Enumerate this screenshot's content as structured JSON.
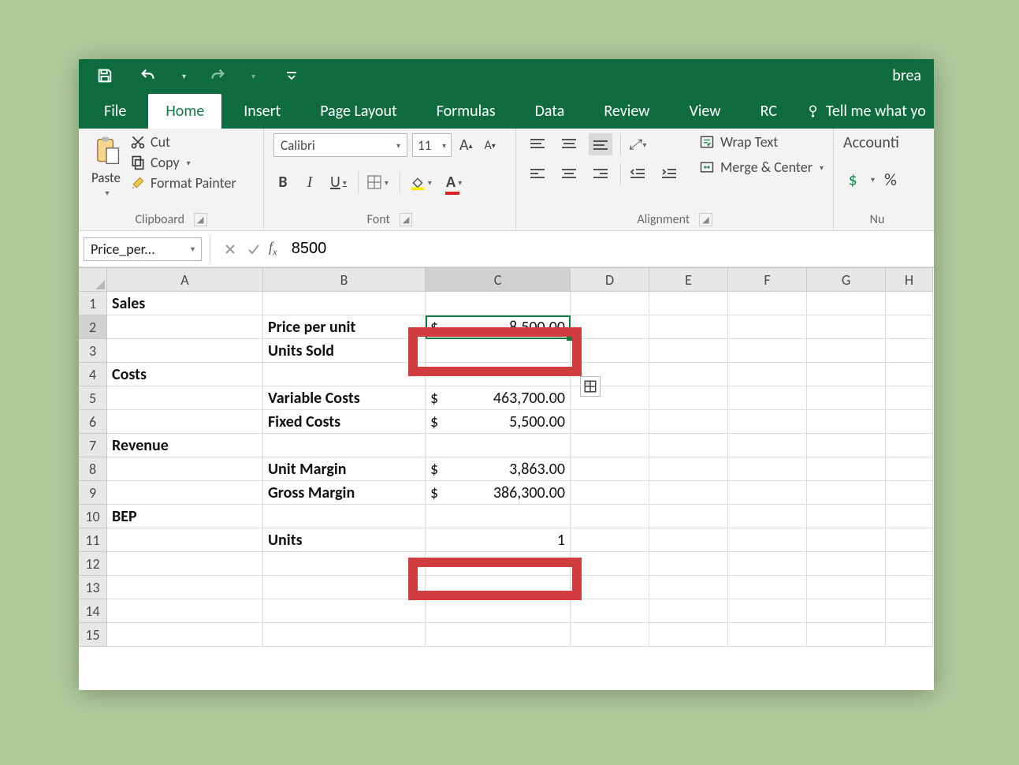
{
  "doc_title": "brea",
  "tabs": {
    "file": "File",
    "home": "Home",
    "insert": "Insert",
    "page_layout": "Page Layout",
    "formulas": "Formulas",
    "data": "Data",
    "review": "Review",
    "view": "View",
    "rc": "RC",
    "tell_me": "Tell me what yo"
  },
  "clipboard": {
    "paste": "Paste",
    "cut": "Cut",
    "copy": "Copy",
    "format_painter": "Format Painter",
    "group": "Clipboard"
  },
  "font": {
    "name": "Calibri",
    "size": "11",
    "group": "Font"
  },
  "alignment": {
    "wrap_text": "Wrap Text",
    "merge_center": "Merge & Center",
    "group": "Alignment"
  },
  "number": {
    "format": "Accounti",
    "group": "Nu",
    "currency": "$",
    "percent": "%"
  },
  "name_box": "Price_per...",
  "formula_value": "8500",
  "columns": [
    "A",
    "B",
    "C",
    "D",
    "E",
    "F",
    "G",
    "H"
  ],
  "rows": [
    {
      "n": "1",
      "A": "Sales",
      "B": "",
      "C": ""
    },
    {
      "n": "2",
      "A": "",
      "B": "Price per unit",
      "C_sym": "$",
      "C_val": "8,500.00"
    },
    {
      "n": "3",
      "A": "",
      "B": "Units Sold",
      "C": ""
    },
    {
      "n": "4",
      "A": "Costs",
      "B": "",
      "C": ""
    },
    {
      "n": "5",
      "A": "",
      "B": "Variable Costs",
      "C_sym": "$",
      "C_val": "463,700.00"
    },
    {
      "n": "6",
      "A": "",
      "B": "Fixed Costs",
      "C_sym": "$",
      "C_val": "5,500.00"
    },
    {
      "n": "7",
      "A": "Revenue",
      "B": "",
      "C": ""
    },
    {
      "n": "8",
      "A": "",
      "B": "Unit Margin",
      "C_sym": "$",
      "C_val": "3,863.00"
    },
    {
      "n": "9",
      "A": "",
      "B": "Gross Margin",
      "C_sym": "$",
      "C_val": "386,300.00"
    },
    {
      "n": "10",
      "A": "BEP",
      "B": "",
      "C": ""
    },
    {
      "n": "11",
      "A": "",
      "B": "Units",
      "C_right": "1"
    },
    {
      "n": "12",
      "A": "",
      "B": "",
      "C": ""
    },
    {
      "n": "13",
      "A": "",
      "B": "",
      "C": ""
    },
    {
      "n": "14",
      "A": "",
      "B": "",
      "C": ""
    },
    {
      "n": "15",
      "A": "",
      "B": "",
      "C": ""
    }
  ]
}
